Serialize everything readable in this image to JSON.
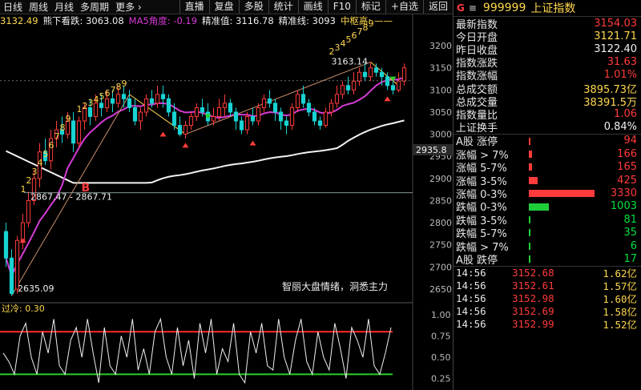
{
  "toolbar": {
    "left_items": [
      "日线",
      "周线",
      "月线",
      "多周期",
      "更多 ›"
    ],
    "right_buttons": [
      "直播",
      "复盘",
      "多股",
      "统计",
      "画线",
      "F10",
      "标记",
      "+自选",
      "返回"
    ]
  },
  "infobar": {
    "partial_value": "3132.49",
    "indicator1": "熊下看跌: 3063.08",
    "indicator2": "MA5角度: -0.19",
    "indicator3": "精准值: 3116.78",
    "indicator4": "精准线: 3093",
    "indicator5": "中枢高: ——"
  },
  "colors": {
    "up": "#ff3b3b",
    "down": "#19d3d3",
    "ma_short": "#d63bd6",
    "ma_long": "#f2f2f2",
    "trend": "#c98e6a",
    "osc": "#f0f0f0",
    "osc_hi": "#ff2b2b",
    "osc_lo": "#28d028",
    "accent": "#ffd84d"
  },
  "chart_data": [
    {
      "type": "candlestick",
      "ylim": [
        2630,
        3240
      ],
      "y_ticks": [
        2650,
        2700,
        2750,
        2800,
        2850,
        2900,
        2950,
        3000,
        3050,
        3100,
        3150,
        3200
      ],
      "price_marker": "2935.8",
      "reference_level": 2867.71,
      "annotations": {
        "low": "2635.09",
        "range_label": "2867.47 - 2867.71",
        "peak": "3163.14",
        "b_marker": "B",
        "watermark": "智丽大盘情绪，洞悉主力"
      },
      "count_labels_1": [
        "1",
        "2",
        "3",
        "4",
        "5",
        "6",
        "7",
        "8",
        "9"
      ],
      "count_labels_2": [
        "1",
        "2",
        "3",
        "4",
        "5",
        "6",
        "7",
        "8",
        "9"
      ],
      "count_labels_3": [
        "2",
        "3",
        "4",
        "5",
        "6",
        "7",
        "8",
        "9"
      ],
      "candles": [
        [
          2780,
          2720,
          2800,
          2700
        ],
        [
          2720,
          2640,
          2740,
          2635.09
        ],
        [
          2650,
          2760,
          2770,
          2640
        ],
        [
          2760,
          2800,
          2820,
          2740
        ],
        [
          2800,
          2850,
          2870,
          2790
        ],
        [
          2850,
          2900,
          2920,
          2840
        ],
        [
          2900,
          2960,
          2980,
          2880
        ],
        [
          2960,
          2940,
          2990,
          2930
        ],
        [
          2940,
          2990,
          3010,
          2920
        ],
        [
          2990,
          3010,
          3030,
          2970
        ],
        [
          3010,
          3000,
          3040,
          2980
        ],
        [
          3000,
          3030,
          3050,
          2990
        ],
        [
          3030,
          2980,
          3050,
          2960
        ],
        [
          2980,
          3030,
          3040,
          2970
        ],
        [
          3030,
          3060,
          3070,
          3010
        ],
        [
          3060,
          3040,
          3080,
          3020
        ],
        [
          3040,
          3070,
          3090,
          3030
        ],
        [
          3070,
          3060,
          3090,
          3040
        ],
        [
          3060,
          3080,
          3100,
          3050
        ],
        [
          3080,
          3070,
          3100,
          3050
        ],
        [
          3070,
          3090,
          3110,
          3060
        ],
        [
          3090,
          3080,
          3110,
          3060
        ],
        [
          3080,
          3060,
          3100,
          3050
        ],
        [
          3060,
          3030,
          3080,
          3020
        ],
        [
          3030,
          3050,
          3060,
          3010
        ],
        [
          3050,
          3080,
          3090,
          3040
        ],
        [
          3080,
          3070,
          3100,
          3060
        ],
        [
          3070,
          3090,
          3110,
          3060
        ],
        [
          3090,
          3080,
          3110,
          3060
        ],
        [
          3080,
          3050,
          3090,
          3040
        ],
        [
          3050,
          3020,
          3070,
          3010
        ],
        [
          3020,
          3000,
          3040,
          2995
        ],
        [
          3000,
          3020,
          3030,
          2990
        ],
        [
          3020,
          3040,
          3050,
          3010
        ],
        [
          3040,
          3060,
          3070,
          3030
        ],
        [
          3060,
          3050,
          3080,
          3040
        ],
        [
          3050,
          3030,
          3070,
          3020
        ],
        [
          3030,
          3040,
          3060,
          3020
        ],
        [
          3040,
          3060,
          3080,
          3030
        ],
        [
          3060,
          3070,
          3090,
          3040
        ],
        [
          3070,
          3050,
          3080,
          3040
        ],
        [
          3050,
          3030,
          3060,
          3010
        ],
        [
          3030,
          3010,
          3040,
          3000
        ],
        [
          3010,
          3040,
          3050,
          3000
        ],
        [
          3040,
          3030,
          3060,
          3020
        ],
        [
          3030,
          3060,
          3070,
          3020
        ],
        [
          3060,
          3080,
          3090,
          3050
        ],
        [
          3080,
          3070,
          3100,
          3060
        ],
        [
          3070,
          3050,
          3080,
          3030
        ],
        [
          3050,
          3030,
          3060,
          3010
        ],
        [
          3030,
          3020,
          3040,
          3000
        ],
        [
          3020,
          3060,
          3070,
          3010
        ],
        [
          3060,
          3090,
          3100,
          3050
        ],
        [
          3090,
          3070,
          3110,
          3060
        ],
        [
          3070,
          3050,
          3080,
          3040
        ],
        [
          3050,
          3030,
          3060,
          3020
        ],
        [
          3030,
          3020,
          3040,
          3010
        ],
        [
          3020,
          3050,
          3060,
          3015
        ],
        [
          3050,
          3070,
          3080,
          3040
        ],
        [
          3070,
          3090,
          3110,
          3060
        ],
        [
          3090,
          3110,
          3120,
          3080
        ],
        [
          3110,
          3100,
          3130,
          3090
        ],
        [
          3100,
          3120,
          3140,
          3090
        ],
        [
          3120,
          3140,
          3150,
          3110
        ],
        [
          3140,
          3130,
          3160,
          3120
        ],
        [
          3130,
          3150,
          3163.14,
          3120
        ],
        [
          3150,
          3140,
          3160,
          3130
        ],
        [
          3140,
          3130,
          3150,
          3110
        ],
        [
          3130,
          3110,
          3140,
          3100
        ],
        [
          3110,
          3100,
          3130,
          3090
        ],
        [
          3100,
          3120,
          3140,
          3095
        ],
        [
          3120,
          3150,
          3160,
          3110
        ]
      ]
    },
    {
      "type": "line",
      "title": "过冷: 0.30",
      "ylim": [
        0.2,
        1.0
      ],
      "y_ticks": [
        0.25,
        0.5,
        0.75,
        1.0
      ],
      "upper_level": 0.8,
      "lower_level": 0.3,
      "values": [
        0.55,
        0.45,
        0.3,
        0.75,
        0.9,
        0.5,
        0.3,
        0.8,
        0.55,
        0.95,
        0.4,
        0.3,
        0.7,
        0.85,
        0.5,
        0.95,
        0.55,
        0.2,
        0.85,
        0.4,
        0.3,
        0.75,
        0.5,
        0.95,
        0.35,
        0.6,
        0.3,
        0.8,
        0.95,
        0.5,
        0.3,
        0.85,
        0.4,
        0.7,
        0.25,
        0.9,
        0.55,
        0.95,
        0.3,
        0.6,
        0.45,
        0.9,
        0.3,
        0.2,
        0.8,
        0.55,
        0.9,
        0.4,
        0.35,
        0.95,
        0.5,
        0.3,
        0.7,
        0.95,
        0.45,
        0.3,
        0.8,
        0.5,
        0.35,
        0.9,
        0.6,
        0.25,
        0.85,
        0.7,
        0.5,
        0.95,
        0.4,
        0.3,
        0.55,
        0.85
      ]
    }
  ],
  "panel": {
    "flag": "G",
    "menu_icon": "≡",
    "code": "999999",
    "name": "上证指数",
    "quote_rows": [
      {
        "label": "最新指数",
        "value": "3154.03",
        "color": "red"
      },
      {
        "label": "今日开盘",
        "value": "3121.71",
        "color": "yel"
      },
      {
        "label": "昨日收盘",
        "value": "3122.40",
        "color": "wht"
      },
      {
        "label": "指数涨跌",
        "value": "31.63",
        "color": "red"
      },
      {
        "label": "指数涨幅",
        "value": "1.01%",
        "color": "red"
      },
      {
        "label": "总成交额",
        "value": "3895.73亿",
        "color": "yel"
      },
      {
        "label": "总成交量",
        "value": "38391.5万",
        "color": "yel"
      },
      {
        "label": "指数量比",
        "value": "1.06",
        "color": "red"
      },
      {
        "label": "上证换手",
        "value": "0.84%",
        "color": "wht"
      }
    ],
    "breadth": [
      {
        "label": "A股 涨停",
        "value": "94",
        "color": "red",
        "max_share": 0.0
      },
      {
        "label": "涨幅 > 7%",
        "value": "166",
        "color": "red",
        "max_share": 0.05
      },
      {
        "label": "涨幅 5-7%",
        "value": "165",
        "color": "red",
        "max_share": 0.05
      },
      {
        "label": "涨幅 3-5%",
        "value": "425",
        "color": "red",
        "max_share": 0.13
      },
      {
        "label": "涨幅 0-3%",
        "value": "3330",
        "color": "red",
        "max_share": 1.0
      },
      {
        "label": "跌幅 0-3%",
        "value": "1003",
        "color": "grn",
        "max_share": 0.3
      },
      {
        "label": "跌幅 3-5%",
        "value": "81",
        "color": "grn",
        "max_share": 0.0
      },
      {
        "label": "跌幅 5-7%",
        "value": "35",
        "color": "grn",
        "max_share": 0.0
      },
      {
        "label": "跌幅 > 7%",
        "value": "6",
        "color": "grn",
        "max_share": 0.0
      },
      {
        "label": "A股 跌停",
        "value": "17",
        "color": "grn",
        "max_share": 0.0
      }
    ],
    "ticks": [
      {
        "time": "14:56",
        "price": "3152.68",
        "amount": "1.62亿"
      },
      {
        "time": "14:56",
        "price": "3152.61",
        "amount": "1.57亿"
      },
      {
        "time": "14:56",
        "price": "3152.98",
        "amount": "1.60亿"
      },
      {
        "time": "14:56",
        "price": "3152.69",
        "amount": "1.58亿"
      },
      {
        "time": "14:56",
        "price": "3152.99",
        "amount": "1.52亿"
      }
    ]
  }
}
